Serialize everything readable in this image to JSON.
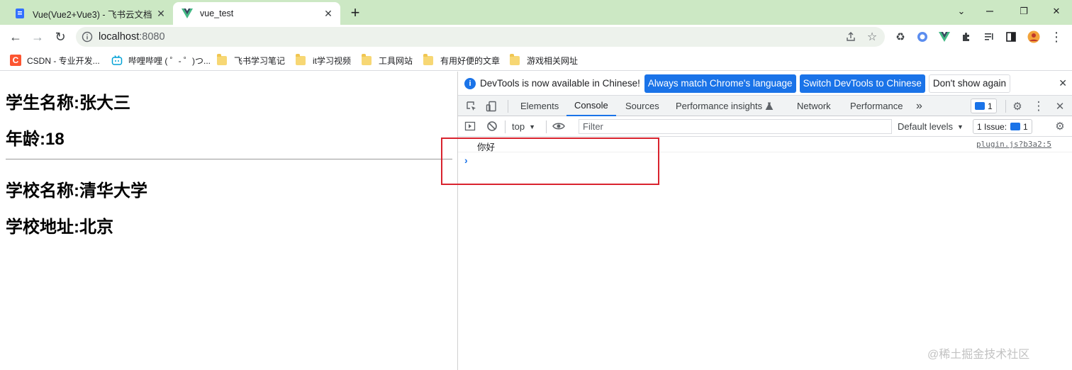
{
  "browser": {
    "tabs": [
      {
        "title": "Vue(Vue2+Vue3) - 飞书云文档",
        "close": "✕",
        "active": false
      },
      {
        "title": "vue_test",
        "close": "✕",
        "active": true
      }
    ],
    "new_tab": "+",
    "window_controls": {
      "minimize": "⌄",
      "restore": "❐",
      "close": "✕"
    },
    "nav": {
      "back": "←",
      "forward": "→",
      "reload": "↻"
    },
    "url_host": "localhost",
    "url_port": ":8080"
  },
  "bookmarks": [
    {
      "label": "CSDN - 专业开发..."
    },
    {
      "label": "哔哩哔哩 ( ゜- ゜)つ..."
    },
    {
      "label": "飞书学习笔记"
    },
    {
      "label": "it学习视频"
    },
    {
      "label": "工具网站"
    },
    {
      "label": "有用好便的文章"
    },
    {
      "label": "游戏相关网址"
    }
  ],
  "page": {
    "student_name": "学生名称:张大三",
    "age": "年龄:18",
    "school_name": "学校名称:清华大学",
    "school_address": "学校地址:北京"
  },
  "devtools": {
    "infobar": {
      "message": "DevTools is now available in Chinese!",
      "primary1": "Always match Chrome's language",
      "primary2": "Switch DevTools to Chinese",
      "secondary": "Don't show again",
      "close": "✕"
    },
    "tabs": [
      "Elements",
      "Console",
      "Sources",
      "Performance insights",
      "Network",
      "Performance"
    ],
    "more_tabs": "»",
    "message_count": "1",
    "console": {
      "context": "top",
      "filter_placeholder": "Filter",
      "levels": "Default levels",
      "issues_label": "1 Issue:",
      "issues_count": "1",
      "log_text": "你好",
      "log_source": "plugin.js?b3a2:5",
      "prompt": "›"
    }
  },
  "watermark": "@稀土掘金技术社区",
  "colors": {
    "tabstrip": "#cce8c4",
    "accent": "#1a73e8",
    "highlight": "#d9232e"
  }
}
